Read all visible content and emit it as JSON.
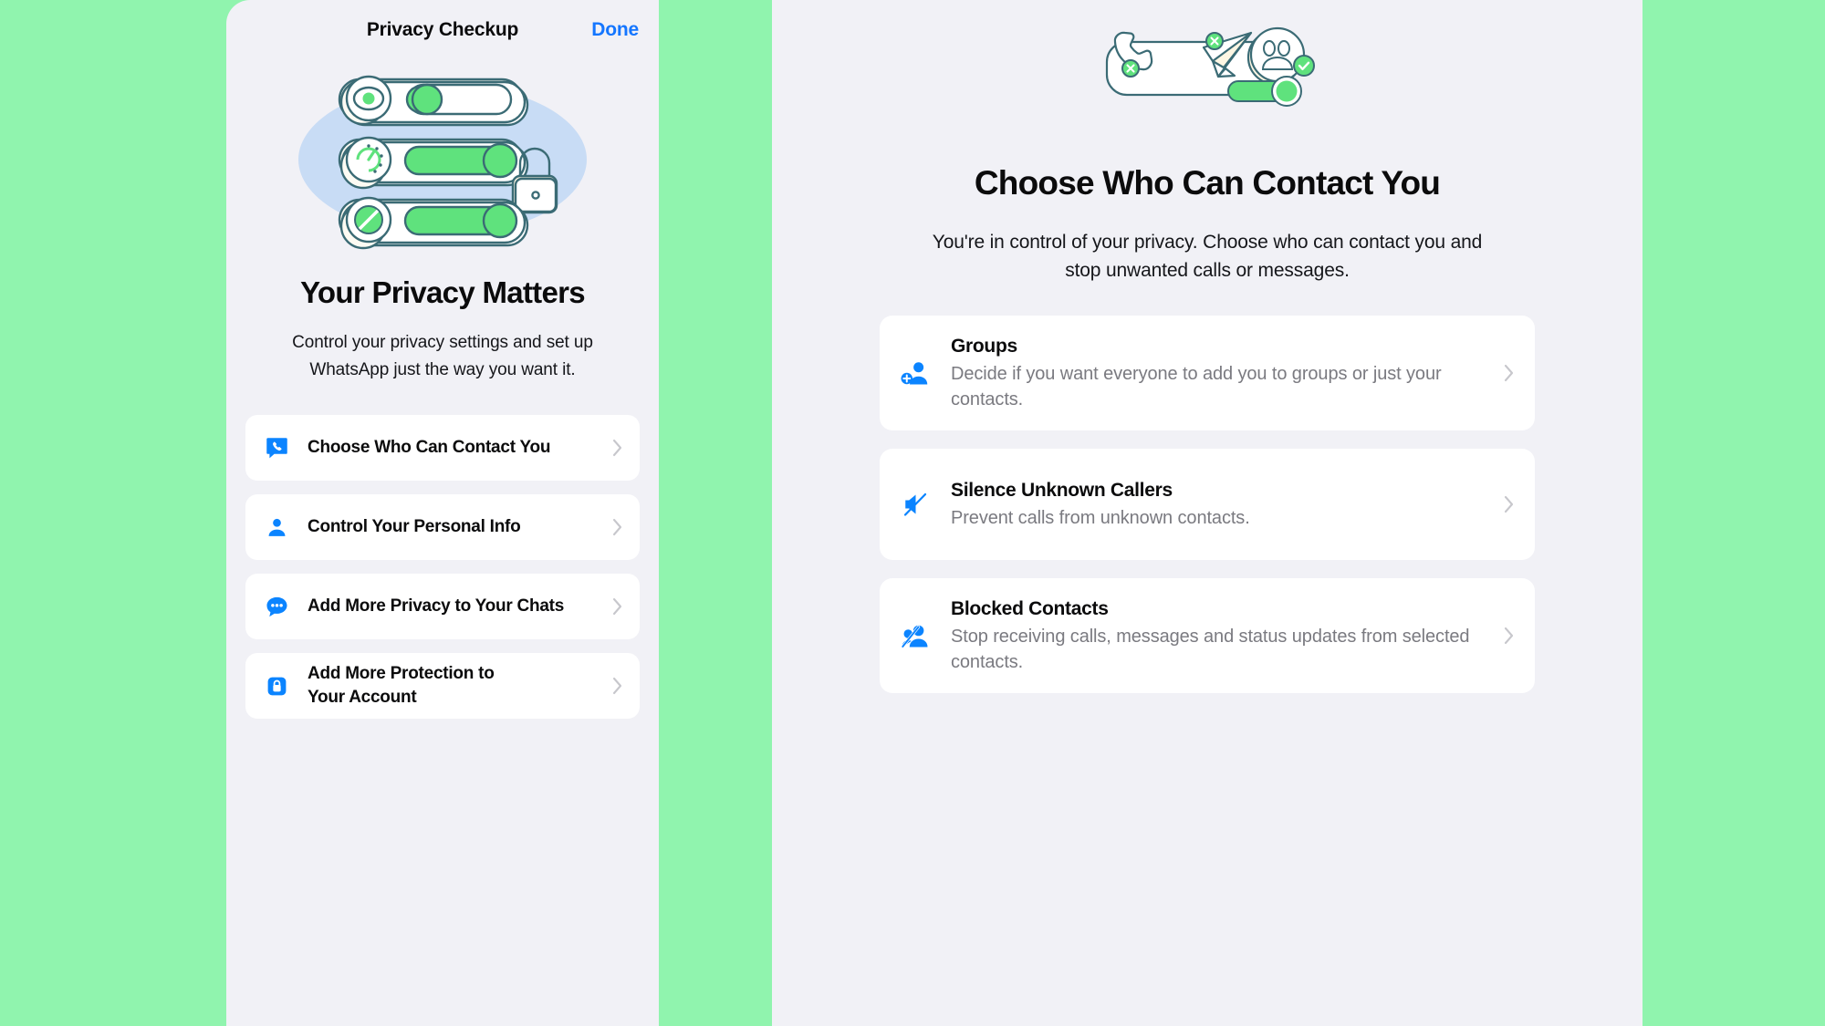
{
  "theme": {
    "page_background": "#90F4AE",
    "panel_background": "#F1F1F6",
    "card_background": "#FFFFFF",
    "accent_blue": "#1476FF",
    "icon_blue": "#0B84FF",
    "accent_green": "#5FE27D",
    "illustration_stroke": "#3B6B75",
    "illustration_oval": "#C8DCF5",
    "text_primary": "#0B0B0C",
    "text_secondary": "#7A7A80",
    "chevron_gray": "#C7C7CC"
  },
  "left_panel": {
    "nav": {
      "title": "Privacy Checkup",
      "done_label": "Done"
    },
    "illustration": {
      "name": "privacy-toggles-illustration",
      "rows": [
        {
          "icon": "eye-icon",
          "toggle": "on-partial"
        },
        {
          "icon": "timer-icon",
          "toggle": "on"
        },
        {
          "icon": "block-icon",
          "toggle": "on"
        }
      ],
      "extra": "padlock-icon"
    },
    "title": "Your Privacy Matters",
    "subtitle": "Control your privacy settings and set up WhatsApp just the way you want it.",
    "items": [
      {
        "icon": "phone-bubble-icon",
        "label": "Choose Who Can Contact You"
      },
      {
        "icon": "person-icon",
        "label": "Control Your Personal Info"
      },
      {
        "icon": "chat-dots-icon",
        "label": "Add More Privacy to Your Chats"
      },
      {
        "icon": "lock-square-icon",
        "label": "Add More Protection to\nYour Account"
      }
    ]
  },
  "right_panel": {
    "illustration": {
      "name": "contact-controls-illustration",
      "elements": [
        "phone-handset-x-icon",
        "paper-plane-x-icon",
        "people-check-icon",
        "green-toggle"
      ]
    },
    "title": "Choose Who Can Contact You",
    "subtitle": "You're in control of your privacy. Choose who can contact you and stop unwanted calls or messages.",
    "cards": [
      {
        "icon": "person-add-icon",
        "title": "Groups",
        "desc": "Decide if you want everyone to add you to groups or just your contacts."
      },
      {
        "icon": "speaker-mute-icon",
        "title": "Silence Unknown Callers",
        "desc": "Prevent calls from unknown contacts."
      },
      {
        "icon": "people-blocked-icon",
        "title": "Blocked Contacts",
        "desc": "Stop receiving calls, messages and status updates from selected contacts."
      }
    ]
  }
}
